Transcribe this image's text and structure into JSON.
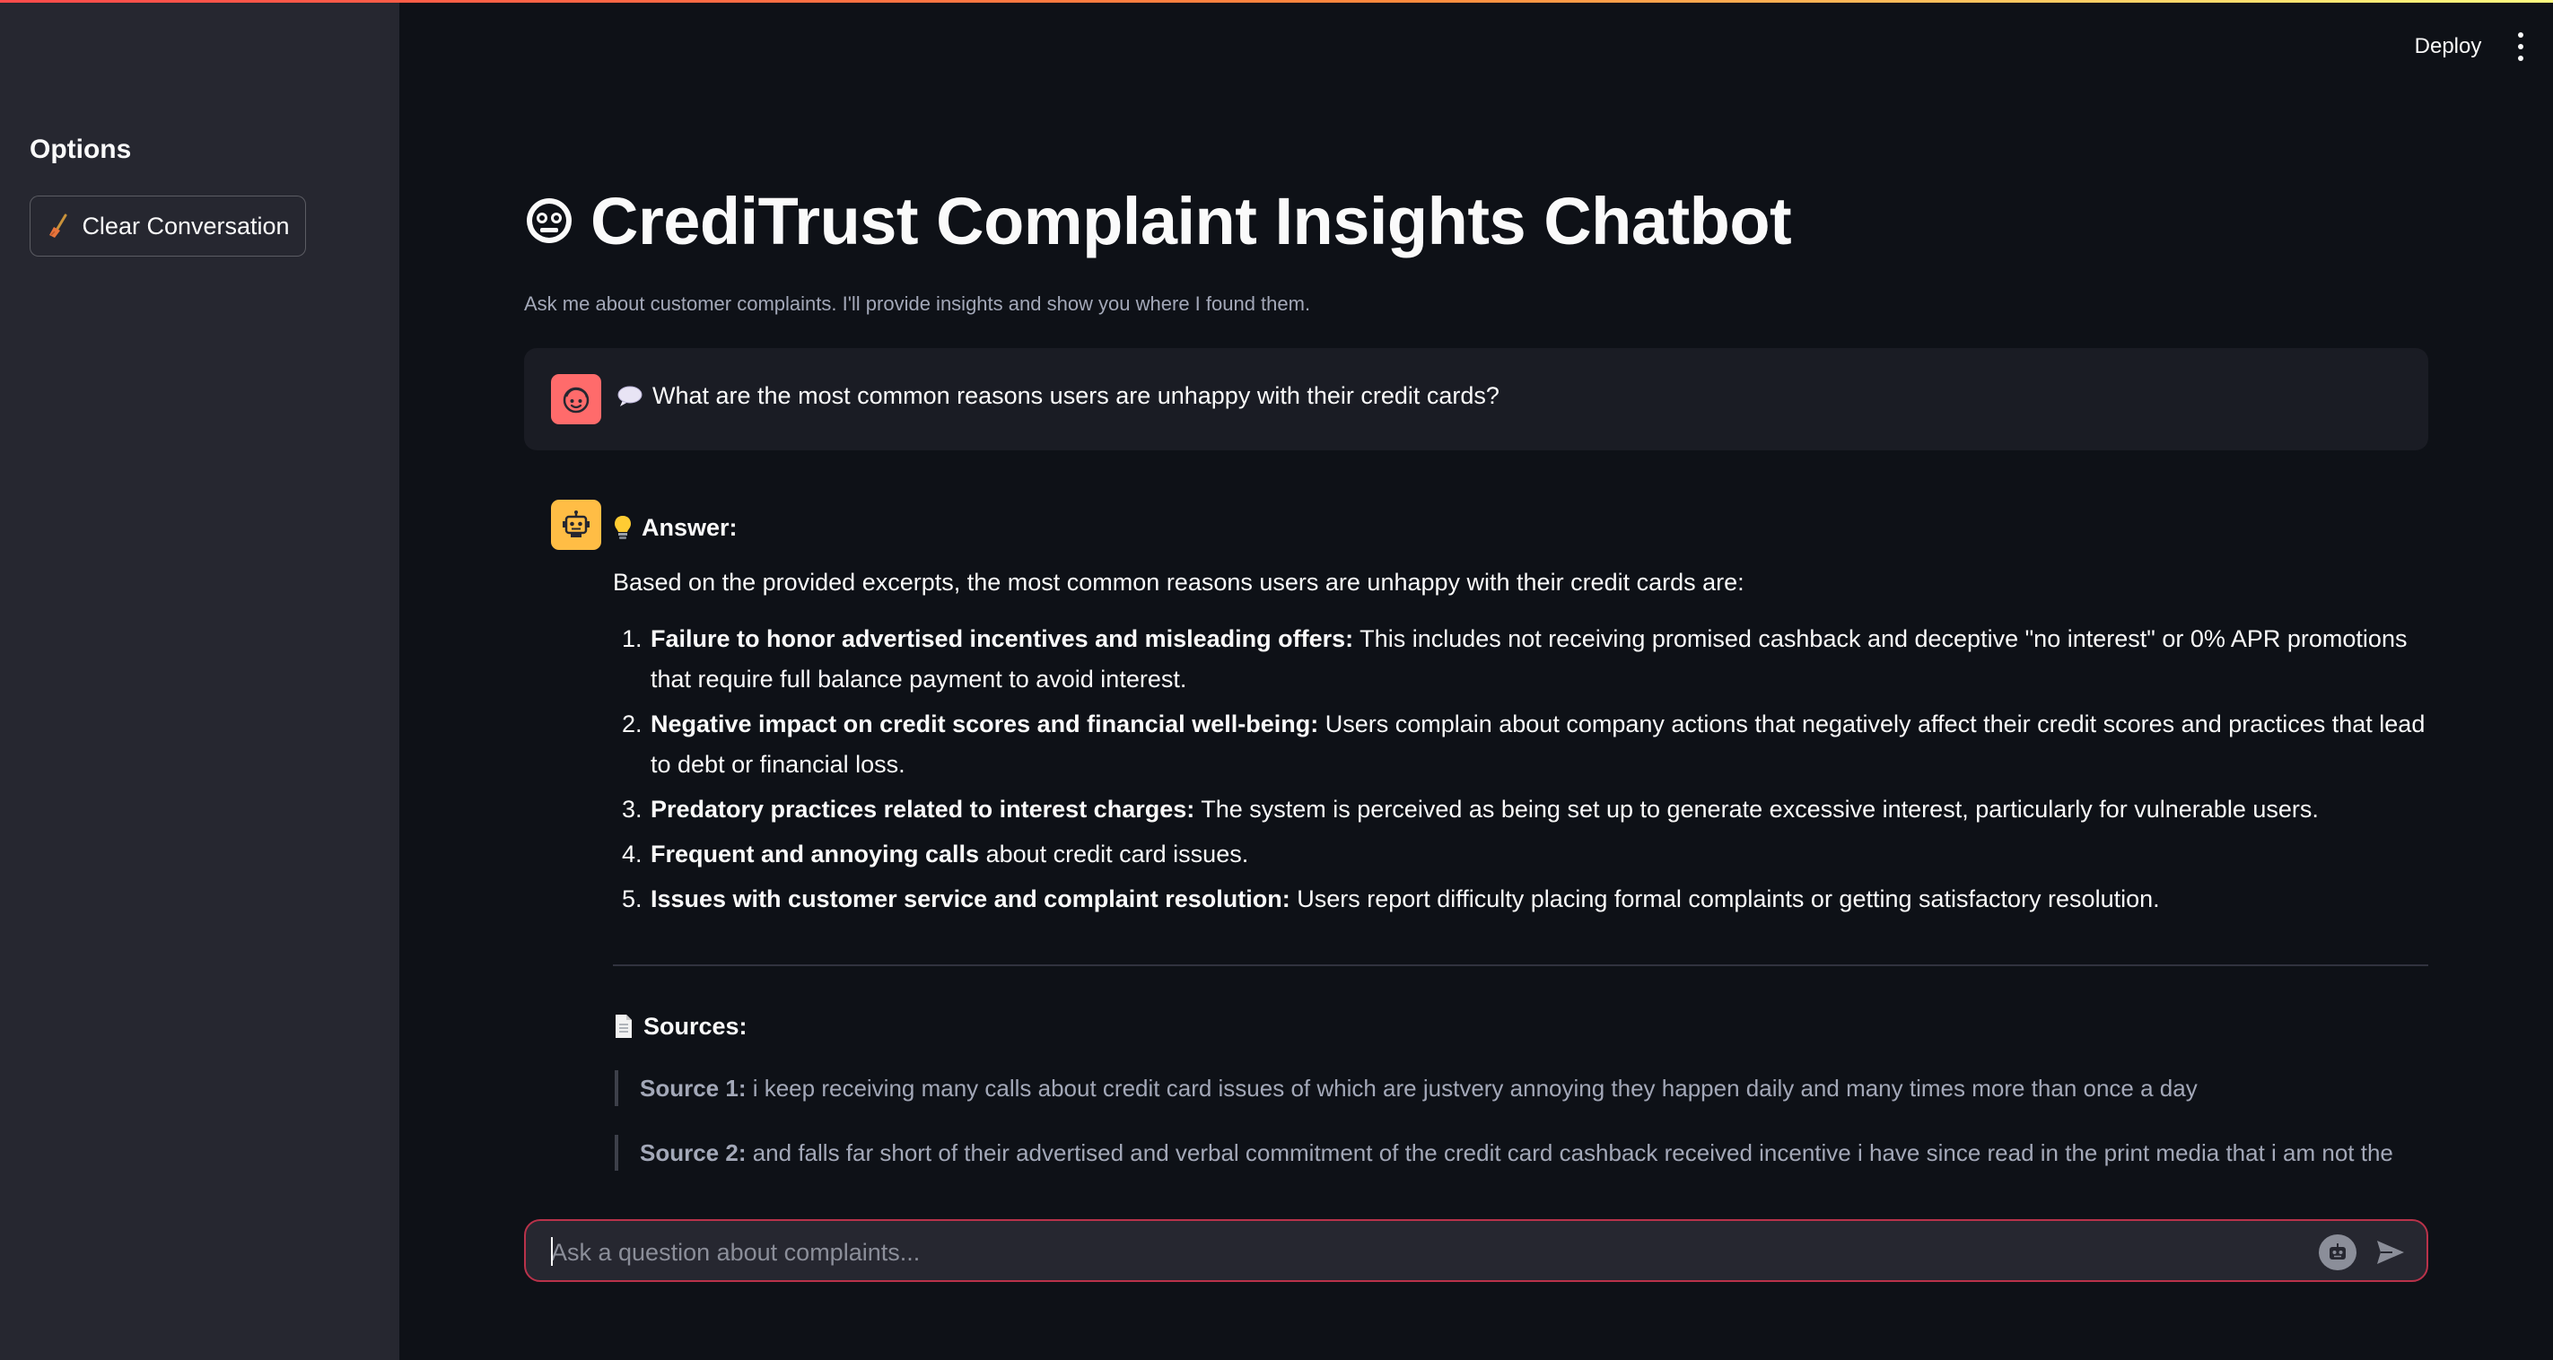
{
  "sidebar": {
    "title": "Options",
    "clear_button_label": "Clear Conversation",
    "clear_button_icon": "broom-icon"
  },
  "header": {
    "deploy_label": "Deploy",
    "menu_icon": "more-vertical-icon"
  },
  "main": {
    "title": "CrediTrust Complaint Insights Chatbot",
    "title_icon": "robot-face-icon",
    "caption": "Ask me about customer complaints. I'll provide insights and show you where I found them."
  },
  "messages": {
    "user": {
      "avatar_icon": "user-face-icon",
      "prefix_icon": "speech-bubble-icon",
      "text": "What are the most common reasons users are unhappy with their credit cards?"
    },
    "assistant": {
      "avatar_icon": "robot-icon",
      "answer_icon": "lightbulb-icon",
      "answer_label": "Answer:",
      "intro": "Based on the provided excerpts, the most common reasons users are unhappy with their credit cards are:",
      "reasons": [
        {
          "bold": "Failure to honor advertised incentives and misleading offers:",
          "text": " This includes not receiving promised cashback and deceptive \"no interest\" or 0% APR promotions that require full balance payment to avoid interest."
        },
        {
          "bold": "Negative impact on credit scores and financial well-being:",
          "text": " Users complain about company actions that negatively affect their credit scores and practices that lead to debt or financial loss."
        },
        {
          "bold": "Predatory practices related to interest charges:",
          "text": " The system is perceived as being set up to generate excessive interest, particularly for vulnerable users."
        },
        {
          "bold": "Frequent and annoying calls",
          "text": " about credit card issues."
        },
        {
          "bold": "Issues with customer service and complaint resolution:",
          "text": " Users report difficulty placing formal complaints or getting satisfactory resolution."
        }
      ],
      "sources_icon": "document-icon",
      "sources_label": "Sources:",
      "sources": [
        {
          "label": "Source 1:",
          "text": " i keep receiving many calls about credit card issues of which are justvery annoying they happen daily and many times more than once a day"
        },
        {
          "label": "Source 2:",
          "text": " and falls far short of their advertised and verbal commitment of the credit card cashback received incentive i have since read in the print media that i am not the"
        }
      ]
    }
  },
  "chat_input": {
    "placeholder": "Ask a question about complaints...",
    "assist_icon": "robot-small-icon",
    "send_icon": "send-icon"
  },
  "colors": {
    "background": "#0e1117",
    "sidebar": "#262730",
    "user_avatar": "#ff6b6b",
    "bot_avatar": "#ffbd45",
    "input_border": "#b9324a"
  }
}
